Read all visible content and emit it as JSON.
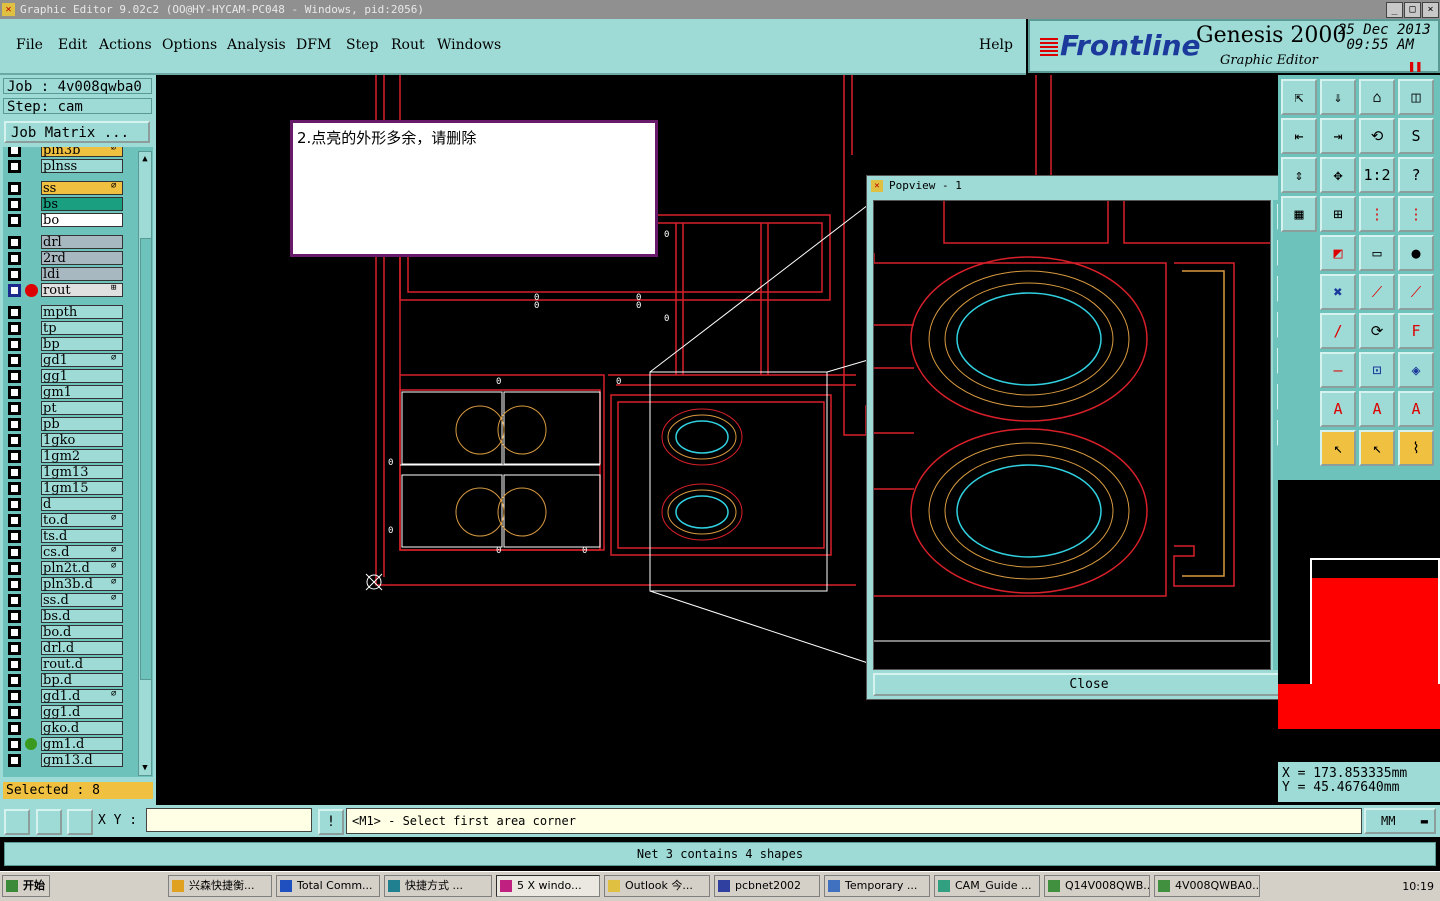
{
  "window": {
    "title": "Graphic Editor 9.02c2 (OO@HY-HYCAM-PC048 - Windows, pid:2056)"
  },
  "menu": {
    "items": [
      "File",
      "Edit",
      "Actions",
      "Options",
      "Analysis",
      "DFM",
      "Step",
      "Rout",
      "Windows"
    ],
    "help": "Help"
  },
  "brand": {
    "logo": "Frontline",
    "product": "Genesis 2000",
    "subtitle": "Graphic Editor",
    "date": "25 Dec 2013",
    "time": "09:55 AM"
  },
  "job": {
    "job_label": "Job : 4v008qwba0",
    "step_label": "Step: cam",
    "matrix_button": "Job Matrix ..."
  },
  "layers": [
    {
      "name": "pln3b",
      "color": "#f0c040",
      "flag": "⌀"
    },
    {
      "name": "plnss",
      "color": "#9edbd6",
      "flag": ""
    },
    {
      "name": "ss",
      "color": "#f0c040",
      "flag": "⌀"
    },
    {
      "name": "bs",
      "color": "#1aa080",
      "flag": ""
    },
    {
      "name": "bo",
      "color": "#ffffff",
      "flag": ""
    },
    {
      "name": "drl",
      "color": "#a8b8c0",
      "flag": ""
    },
    {
      "name": "2rd",
      "color": "#a8b8c0",
      "flag": ""
    },
    {
      "name": "ldi",
      "color": "#a8b8c0",
      "flag": ""
    },
    {
      "name": "rout",
      "color": "#e0e0e0",
      "flag": "⊞"
    },
    {
      "name": "mpth",
      "color": "#9edbd6",
      "flag": ""
    },
    {
      "name": "tp",
      "color": "#9edbd6",
      "flag": ""
    },
    {
      "name": "bp",
      "color": "#9edbd6",
      "flag": ""
    },
    {
      "name": "gd1",
      "color": "#9edbd6",
      "flag": "⌀"
    },
    {
      "name": "gg1",
      "color": "#9edbd6",
      "flag": ""
    },
    {
      "name": "gm1",
      "color": "#9edbd6",
      "flag": ""
    },
    {
      "name": "pt",
      "color": "#9edbd6",
      "flag": ""
    },
    {
      "name": "pb",
      "color": "#9edbd6",
      "flag": ""
    },
    {
      "name": "1gko",
      "color": "#9edbd6",
      "flag": ""
    },
    {
      "name": "1gm2",
      "color": "#9edbd6",
      "flag": ""
    },
    {
      "name": "1gm13",
      "color": "#9edbd6",
      "flag": ""
    },
    {
      "name": "1gm15",
      "color": "#9edbd6",
      "flag": ""
    },
    {
      "name": "d",
      "color": "#9edbd6",
      "flag": ""
    },
    {
      "name": "to.d",
      "color": "#9edbd6",
      "flag": "⌀"
    },
    {
      "name": "ts.d",
      "color": "#9edbd6",
      "flag": ""
    },
    {
      "name": "cs.d",
      "color": "#9edbd6",
      "flag": "⌀"
    },
    {
      "name": "pln2t.d",
      "color": "#9edbd6",
      "flag": "⌀"
    },
    {
      "name": "pln3b.d",
      "color": "#9edbd6",
      "flag": "⌀"
    },
    {
      "name": "ss.d",
      "color": "#9edbd6",
      "flag": "⌀"
    },
    {
      "name": "bs.d",
      "color": "#9edbd6",
      "flag": ""
    },
    {
      "name": "bo.d",
      "color": "#9edbd6",
      "flag": ""
    },
    {
      "name": "drl.d",
      "color": "#9edbd6",
      "flag": ""
    },
    {
      "name": "rout.d",
      "color": "#9edbd6",
      "flag": ""
    },
    {
      "name": "bp.d",
      "color": "#9edbd6",
      "flag": ""
    },
    {
      "name": "gd1.d",
      "color": "#9edbd6",
      "flag": "⌀"
    },
    {
      "name": "gg1.d",
      "color": "#9edbd6",
      "flag": ""
    },
    {
      "name": "gko.d",
      "color": "#9edbd6",
      "flag": ""
    },
    {
      "name": "gm1.d",
      "color": "#9edbd6",
      "flag": ""
    },
    {
      "name": "gm13.d",
      "color": "#9edbd6",
      "flag": ""
    }
  ],
  "selected": "Selected : 8",
  "note": "2.点亮的外形多余，请删除",
  "popview": {
    "title": "Popview - 1",
    "close_label": "Close"
  },
  "coords": {
    "x": "X  =  173.853335mm",
    "y": "Y  =  45.467640mm"
  },
  "command": {
    "xy_label": "X Y :",
    "xy_value": "",
    "prompt": "<M1> - Select first area corner",
    "units": "MM"
  },
  "status": "Net 3 contains 4 shapes",
  "taskbar": {
    "start": "开始",
    "items": [
      "兴森快捷衡...",
      "Total Comm...",
      "快捷方式 ...",
      "5 X windo...",
      "Outlook 今...",
      "pcbnet2002",
      "Temporary ...",
      "CAM_Guide ...",
      "Q14V008QWB...",
      "4V008QWBA0..."
    ],
    "clock": "10:19"
  },
  "colors": {
    "panel": "#9edbd6",
    "panel_dark": "#6ec2bc",
    "outline_red": "#d8202a",
    "copper_orange": "#d89a40",
    "cyan_trace": "#30d0e0",
    "highlight_white": "#ffffff"
  }
}
